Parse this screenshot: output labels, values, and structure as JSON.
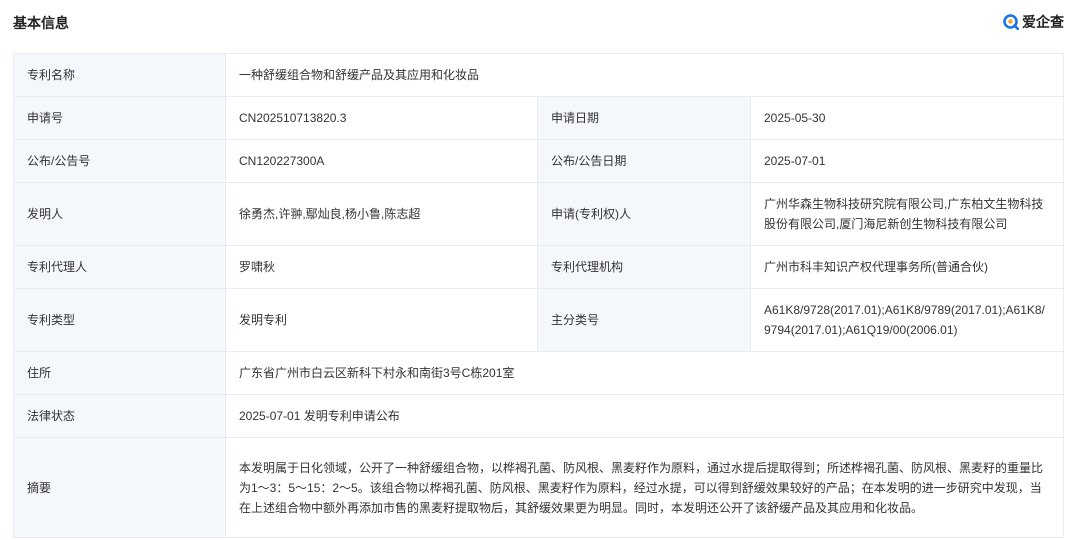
{
  "header": {
    "title": "基本信息",
    "brand_name": "爱企查",
    "brand_icon": "aiqicha-logo-icon",
    "brand_color": "#1a74e8"
  },
  "rows": {
    "patent_name": {
      "label": "专利名称",
      "value": "一种舒缓组合物和舒缓产品及其应用和化妆品"
    },
    "application_no": {
      "label": "申请号",
      "value": "CN202510713820.3"
    },
    "application_date": {
      "label": "申请日期",
      "value": "2025-05-30"
    },
    "publication_no": {
      "label": "公布/公告号",
      "value": "CN120227300A"
    },
    "publication_date": {
      "label": "公布/公告日期",
      "value": "2025-07-01"
    },
    "inventor": {
      "label": "发明人",
      "value": "徐勇杰,许翀,鄢灿良,杨小鲁,陈志超"
    },
    "applicant": {
      "label": "申请(专利权)人",
      "value": "广州华森生物科技研究院有限公司,广东柏文生物科技股份有限公司,厦门海尼新创生物科技有限公司"
    },
    "agent": {
      "label": "专利代理人",
      "value": "罗啸秋"
    },
    "agency": {
      "label": "专利代理机构",
      "value": "广州市科丰知识产权代理事务所(普通合伙)"
    },
    "patent_type": {
      "label": "专利类型",
      "value": "发明专利"
    },
    "main_class": {
      "label": "主分类号",
      "value": "A61K8/9728(2017.01);A61K8/9789(2017.01);A61K8/9794(2017.01);A61Q19/00(2006.01)"
    },
    "address": {
      "label": "住所",
      "value": "广东省广州市白云区新科下村永和南街3号C栋201室"
    },
    "legal_status": {
      "label": "法律状态",
      "value": "2025-07-01 发明专利申请公布"
    },
    "abstract": {
      "label": "摘要",
      "value": "本发明属于日化领域，公开了一种舒缓组合物，以桦褐孔菌、防风根、黑麦籽作为原料，通过水提后提取得到；所述桦褐孔菌、防风根、黑麦籽的重量比为1～3：5～15：2～5。该组合物以桦褐孔菌、防风根、黑麦籽作为原料，经过水提，可以得到舒缓效果较好的产品；在本发明的进一步研究中发现，当在上述组合物中额外再添加市售的黑麦籽提取物后，其舒缓效果更为明显。同时，本发明还公开了该舒缓产品及其应用和化妆品。"
    }
  }
}
